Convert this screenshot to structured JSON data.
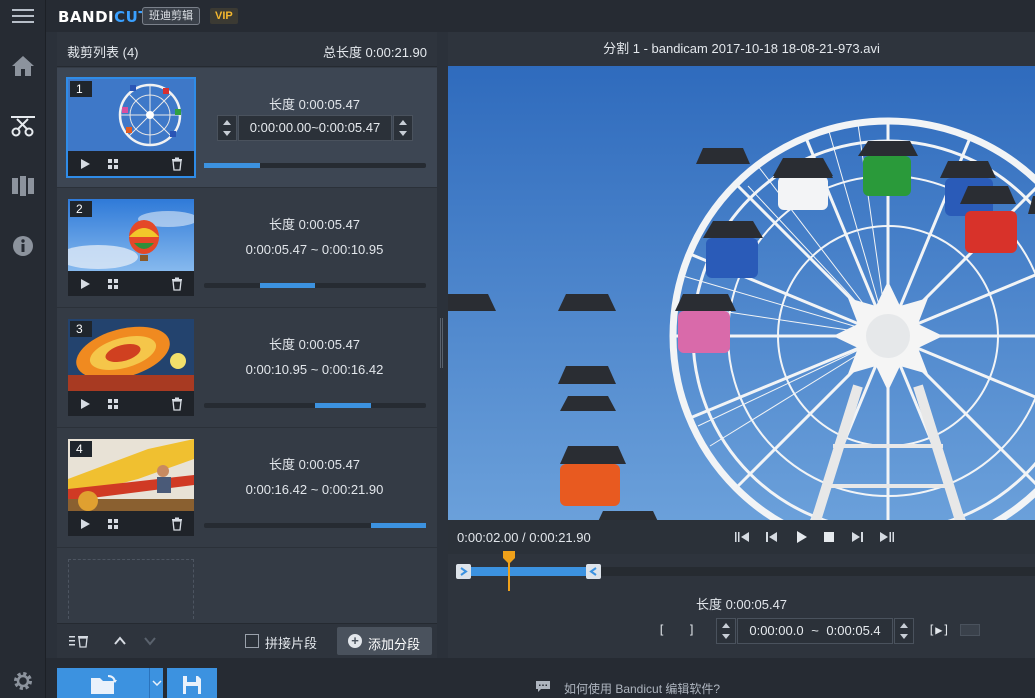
{
  "app": {
    "logo_main": "BANDI",
    "logo_cut": "CUT",
    "logo_sub": "班迪剪辑",
    "vip": "VIP"
  },
  "nav": {
    "items": [
      {
        "icon": "menu-icon"
      },
      {
        "icon": "home-icon"
      },
      {
        "icon": "cut-icon",
        "active": true
      },
      {
        "icon": "join-icon"
      },
      {
        "icon": "info-icon"
      },
      {
        "icon": "settings-icon"
      }
    ]
  },
  "list": {
    "title": "裁剪列表 (4)",
    "total": "总长度 0:00:21.90",
    "segments": [
      {
        "num": "1",
        "length": "长度 0:00:05.47",
        "range": "0:00:00.00~0:00:05.47",
        "fill_start_pct": 0,
        "fill_end_pct": 25,
        "active": true
      },
      {
        "num": "2",
        "length": "长度 0:00:05.47",
        "range": "0:00:05.47 ~ 0:00:10.95",
        "fill_start_pct": 25,
        "fill_end_pct": 50
      },
      {
        "num": "3",
        "length": "长度 0:00:05.47",
        "range": "0:00:10.95 ~ 0:00:16.42",
        "fill_start_pct": 50,
        "fill_end_pct": 75
      },
      {
        "num": "4",
        "length": "长度 0:00:05.47",
        "range": "0:00:16.42 ~ 0:00:21.90",
        "fill_start_pct": 75,
        "fill_end_pct": 100
      }
    ],
    "footer": {
      "merge_label": "拼接片段",
      "merge_checked": false,
      "add_label": "添加分段"
    }
  },
  "preview": {
    "title": "分割 1 - bandicam 2017-10-18 18-08-21-973.avi",
    "time": "0:00:02.00 / 0:00:21.90",
    "selection_start_pct": 0,
    "selection_end_pct": 25,
    "playhead_pct": 9.1,
    "length": "长度 0:00:05.47",
    "start_value": "0:00:00.0",
    "end_value": "0:00:05.4",
    "range_sep": "~",
    "mark_in": "[",
    "mark_out": "]",
    "play_sel": "[▶]"
  },
  "bottom": {
    "help": "如何使用 Bandicut 编辑软件?"
  },
  "colors": {
    "accent": "#3c92e0",
    "vip": "#f3b72e",
    "background": "#2b313a"
  }
}
